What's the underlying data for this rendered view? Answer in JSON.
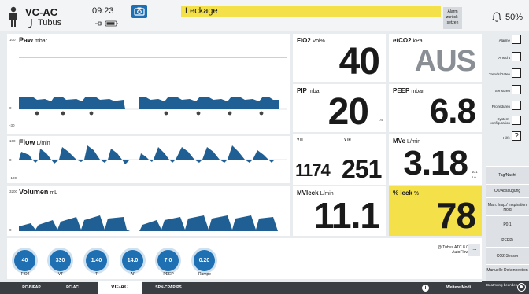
{
  "header": {
    "mode": "VC-AC",
    "airway": "Tubus",
    "time": "09:23",
    "alarm_message": "Leckage",
    "alarm_reset_label": "Alarm zurück-setzen",
    "alarm_volume": "50%"
  },
  "waves": {
    "paw": {
      "title": "Paw",
      "unit": "mbar",
      "scale_top": "100",
      "scale_mid": "0",
      "scale_bottom": "-30"
    },
    "flow": {
      "title": "Flow",
      "unit": "L/min",
      "scale_top": "100",
      "scale_mid": "0",
      "scale_bottom": "-100"
    },
    "volume": {
      "title": "Volumen",
      "unit": "mL",
      "scale_top": "3200",
      "scale_bottom": "0"
    }
  },
  "values": {
    "fio2": {
      "label": "FiO2",
      "unit": "Vol%",
      "value": "40"
    },
    "etco2": {
      "label": "etCO2",
      "unit": "kPa",
      "value": "AUS"
    },
    "pip": {
      "label": "PIP",
      "unit": "mbar",
      "value": "20",
      "small": "75"
    },
    "peep": {
      "label": "PEEP",
      "unit": "mbar",
      "value": "6.8"
    },
    "vti": {
      "label": "VTi",
      "value": "1174"
    },
    "vte": {
      "label": "VTe",
      "value": "251"
    },
    "mve": {
      "label": "MVe",
      "unit": "L/min",
      "value": "3.18",
      "limit_hi": "10.1",
      "limit_lo": "2.0"
    },
    "mvleck": {
      "label": "MVleck",
      "unit": "L/min",
      "value": "11.1"
    },
    "leck": {
      "label": "% leck",
      "unit": "%",
      "value": "78"
    }
  },
  "sidebar": {
    "items": [
      "Alarme",
      "Ansicht",
      "Trends/Daten",
      "Sensoren",
      "Prozeduren",
      "System-konfiguration",
      "Hilfe"
    ],
    "buttons": [
      "Tag/Nacht",
      "O2/Absaugung",
      "Man. Insp./ Inspiration Hold",
      "P0.1",
      "PEEPi",
      "CO2-Sensor",
      "Manuelle Dekonnektion"
    ],
    "start_label": "Beatmung beenden"
  },
  "settings": {
    "knobs": [
      {
        "value": "40",
        "label": "FiO2"
      },
      {
        "value": "330",
        "label": "VT"
      },
      {
        "value": "1.40",
        "label": "Ti"
      },
      {
        "value": "14.0",
        "label": "AF"
      },
      {
        "value": "7.0",
        "label": "PEEP"
      },
      {
        "value": "0.20",
        "label": "Rampe"
      }
    ],
    "atc_line1": "@ Tubus ATC 8.0",
    "atc_line2": "AutoFlow",
    "more": "..."
  },
  "tabs": [
    "PC-BIPAP",
    "PC-AC",
    "VC-AC",
    "SPN-CPAP/PS"
  ],
  "more_modes": "Weitere Modi",
  "info": "i",
  "colors": {
    "wave": "#1f5f94",
    "alarm": "#f4e049",
    "knob": "#1f6fb3",
    "paw_limit": "#e8a27a"
  }
}
